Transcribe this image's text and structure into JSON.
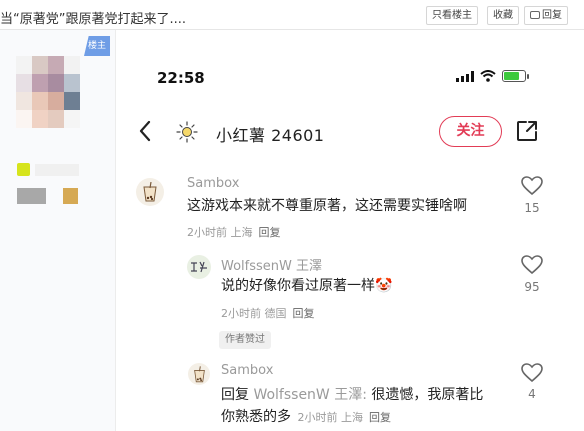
{
  "thread": {
    "title": "当“原著党”跟原著党打起来了....",
    "only_op_label": "只看楼主",
    "favorite_label": "收藏",
    "reply_label": "回复"
  },
  "user_panel": {
    "badge": "楼主"
  },
  "phone": {
    "time": "22:58",
    "battery_percent": 75,
    "profile_name": "小红薯 24601",
    "follow_label": "关注"
  },
  "comments": [
    {
      "nick": "Sambox",
      "text": "这游戏本来就不尊重原著，这还需要实锤啥啊",
      "meta": "2小时前 上海",
      "reply_label": "回复",
      "likes": "15"
    },
    {
      "nick": "WolfssenW 王澤",
      "text": "说的好像你看过原著一样🤡",
      "meta": "2小时前 德国",
      "reply_label": "回复",
      "likes": "95",
      "tag": "作者赞过"
    },
    {
      "nick": "Sambox",
      "reply_prefix": "回复",
      "quoted_nick": "WolfssenW 王澤:",
      "text_line1": " 很遗憾，我原著比",
      "text_line2": "你熟悉的多",
      "meta": "2小时前 上海",
      "reply_label": "回复",
      "likes": "4"
    }
  ],
  "colors": {
    "follow_accent": "#e23c56",
    "badge_blue": "#6f9de6",
    "battery_green": "#3dc93d"
  },
  "icons": [
    "back-chevron-icon",
    "sun-icon",
    "share-icon",
    "heart-icon",
    "wifi-icon",
    "signal-icon",
    "battery-icon"
  ]
}
